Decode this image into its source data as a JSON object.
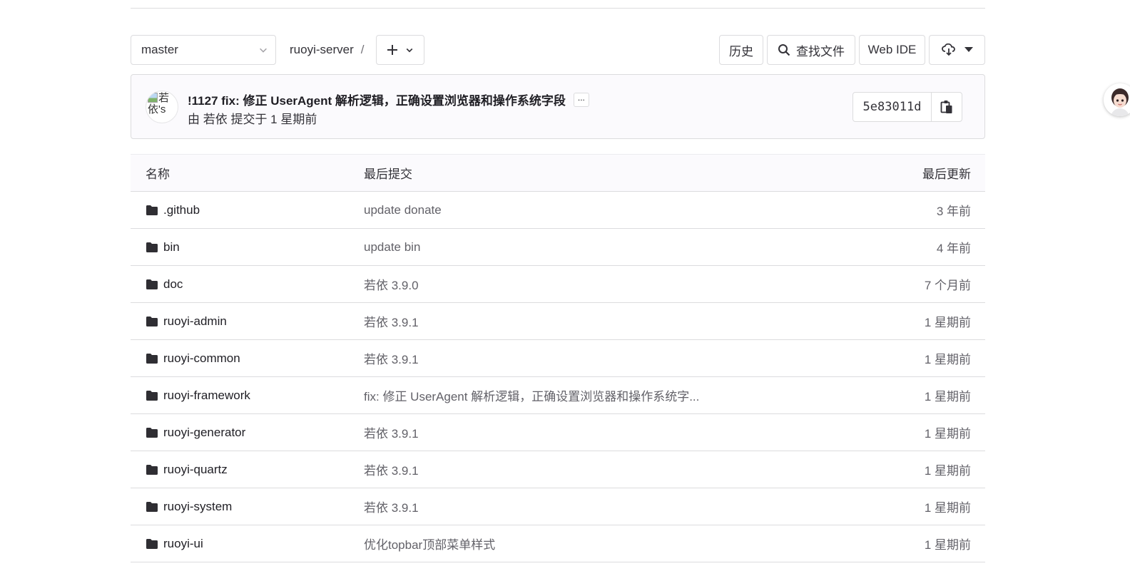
{
  "toolbar": {
    "branch": "master",
    "path": "ruoyi-server",
    "path_separator": "/",
    "history_label": "历史",
    "find_file_label": "查找文件",
    "web_ide_label": "Web IDE"
  },
  "commit": {
    "avatar_alt": "若依's",
    "title": "!1127 fix: 修正 UserAgent 解析逻辑，正确设置浏览器和操作系统字段",
    "ellipsis": "...",
    "meta": "由 若依 提交于 1 星期前",
    "sha": "5e83011d"
  },
  "table": {
    "headers": {
      "name": "名称",
      "last_commit": "最后提交",
      "last_update": "最后更新"
    },
    "rows": [
      {
        "name": ".github",
        "commit": "update donate",
        "updated": "3 年前"
      },
      {
        "name": "bin",
        "commit": "update bin",
        "updated": "4 年前"
      },
      {
        "name": "doc",
        "commit": "若依 3.9.0",
        "updated": "7 个月前"
      },
      {
        "name": "ruoyi-admin",
        "commit": "若依 3.9.1",
        "updated": "1 星期前"
      },
      {
        "name": "ruoyi-common",
        "commit": "若依 3.9.1",
        "updated": "1 星期前"
      },
      {
        "name": "ruoyi-framework",
        "commit": "fix: 修正 UserAgent 解析逻辑，正确设置浏览器和操作系统字...",
        "updated": "1 星期前"
      },
      {
        "name": "ruoyi-generator",
        "commit": "若依 3.9.1",
        "updated": "1 星期前"
      },
      {
        "name": "ruoyi-quartz",
        "commit": "若依 3.9.1",
        "updated": "1 星期前"
      },
      {
        "name": "ruoyi-system",
        "commit": "若依 3.9.1",
        "updated": "1 星期前"
      },
      {
        "name": "ruoyi-ui",
        "commit": "优化topbar顶部菜单样式",
        "updated": "1 星期前"
      }
    ]
  },
  "icons": {
    "branch_dropdown": "chevron-down-icon",
    "add": "plus-icon",
    "find": "search-icon",
    "download": "cloud-download-icon",
    "copy": "copy-icon",
    "folder": "folder-icon"
  }
}
